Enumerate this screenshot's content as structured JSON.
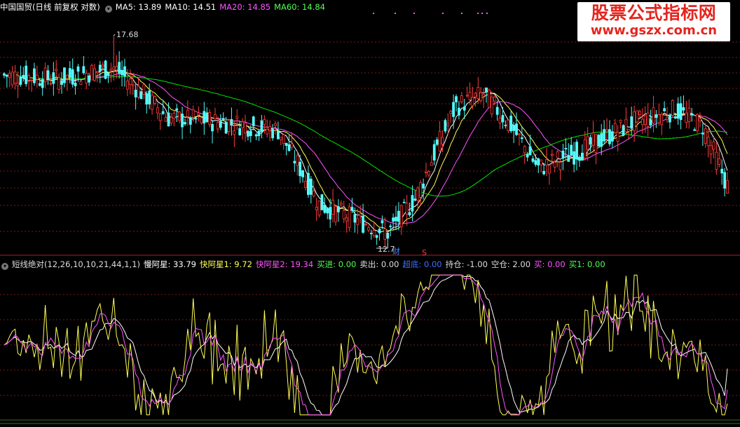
{
  "top_header": {
    "title": "中国国贸(日线 前复权 对数)",
    "ma5": "MA5: 13.89",
    "ma10": "MA10: 14.51",
    "ma20": "MA20: 14.85",
    "ma60": "MA60: 14.84"
  },
  "bottom_header": {
    "formula": "短线绝对(12,26,10,10,21,44,1,1)",
    "slow_star": "慢阿星: 33.79",
    "fast_star1": "快阿星1: 9.72",
    "fast_star2": "快阿星2: 19.34",
    "buy_in": "买进: 0.00",
    "sell_out": "卖出: 0.00",
    "bottom_label": "超底: 0.00",
    "position": "持仓: -1.00",
    "empty": "空仓: 2.00",
    "buy": "买: 0.00",
    "buy1": "买1: 0.00"
  },
  "annotations": {
    "high": "17.68",
    "low": "12.7",
    "fin_mark": "财",
    "s_mark": "S"
  },
  "watermark": {
    "title": "股票公式指标网",
    "url": "www.gszx.com.cn"
  },
  "colors": {
    "up": "#ff3b3b",
    "down": "#54fcfc",
    "ma5": "#ffffff",
    "ma10": "#ffff54",
    "ma20": "#ff54ff",
    "ma60": "#00e600",
    "grid": "#7a1818",
    "slow": "#ffffff",
    "fast1": "#ffff54",
    "fast2": "#ff54ff"
  },
  "chart_data": {
    "type": "candlestick",
    "price_range": [
      12.5,
      18.3
    ],
    "annotated_high": 17.68,
    "annotated_low": 12.7,
    "key_points": [
      {
        "day": 0,
        "close": 16.6
      },
      {
        "day": 20,
        "close": 16.5
      },
      {
        "day": 40,
        "close": 16.8
      },
      {
        "day": 60,
        "close": 15.5
      },
      {
        "day": 80,
        "close": 15.4
      },
      {
        "day": 100,
        "close": 15.2
      },
      {
        "day": 115,
        "close": 13.5
      },
      {
        "day": 140,
        "close": 12.9
      },
      {
        "day": 150,
        "close": 13.6
      },
      {
        "day": 165,
        "close": 15.8
      },
      {
        "day": 175,
        "close": 16.1
      },
      {
        "day": 185,
        "close": 15.3
      },
      {
        "day": 195,
        "close": 14.3
      },
      {
        "day": 210,
        "close": 14.7
      },
      {
        "day": 230,
        "close": 15.4
      },
      {
        "day": 245,
        "close": 15.7
      },
      {
        "day": 255,
        "close": 15.3
      },
      {
        "day": 264,
        "close": 13.9
      }
    ],
    "indicator_range": [
      0,
      100
    ],
    "slow_star_last": 33.79,
    "fast_star1_last": 9.72,
    "fast_star2_last": 19.34
  }
}
